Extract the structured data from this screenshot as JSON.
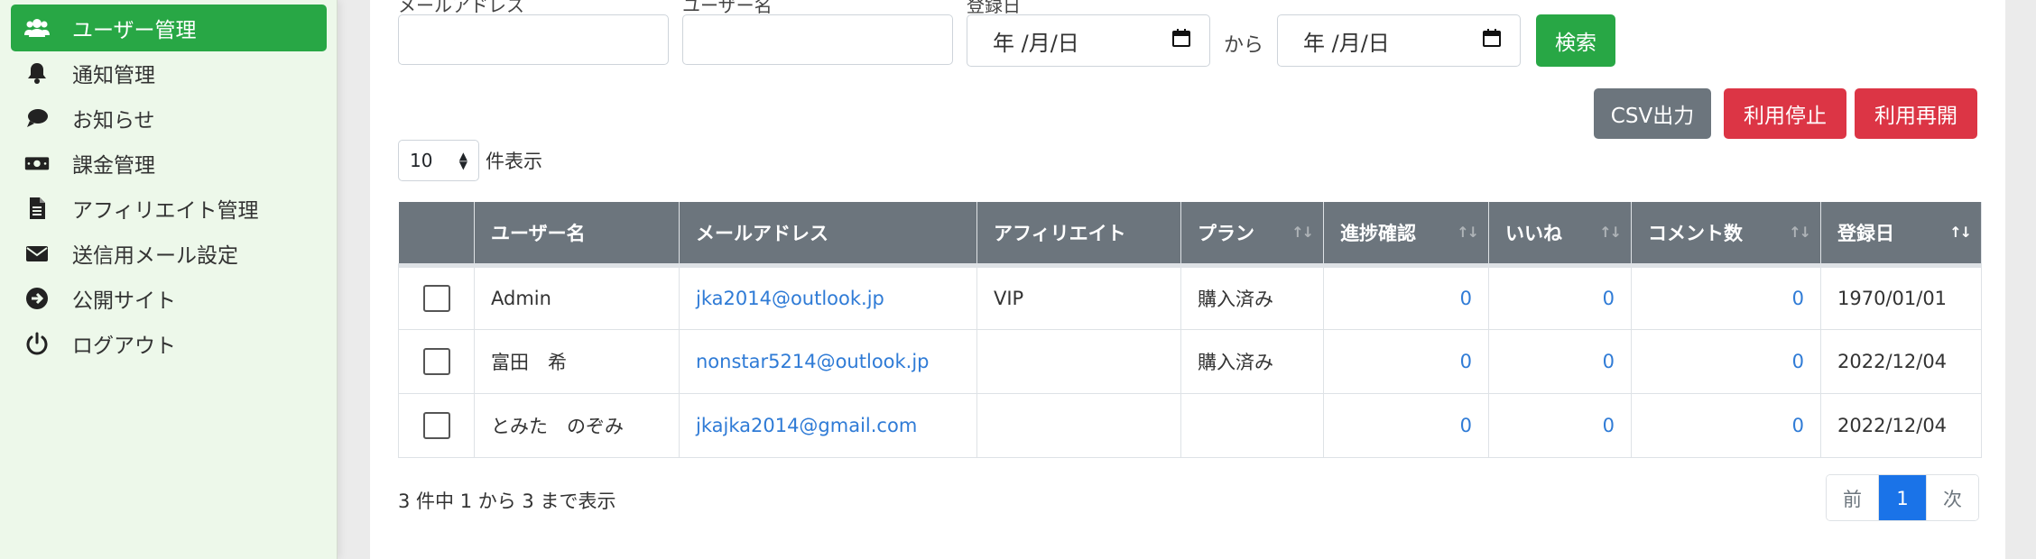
{
  "sidebar": {
    "items": [
      {
        "label": "ユーザー管理",
        "icon": "users-icon",
        "active": true
      },
      {
        "label": "通知管理",
        "icon": "bell-icon"
      },
      {
        "label": "お知らせ",
        "icon": "comment-icon"
      },
      {
        "label": "課金管理",
        "icon": "money-icon"
      },
      {
        "label": "アフィリエイト管理",
        "icon": "document-icon"
      },
      {
        "label": "送信用メール設定",
        "icon": "envelope-icon"
      },
      {
        "label": "公開サイト",
        "icon": "arrow-circle-icon"
      },
      {
        "label": "ログアウト",
        "icon": "power-icon"
      }
    ]
  },
  "filters": {
    "email_label": "メールアドレス",
    "username_label": "ユーザー名",
    "date_label": "登録日",
    "date_from_placeholder": "年 /月/日",
    "date_to_placeholder": "年 /月/日",
    "range_separator": "から",
    "search_button": "検索"
  },
  "actions": {
    "csv": "CSV出力",
    "suspend": "利用停止",
    "resume": "利用再開"
  },
  "page_size": {
    "value": "10",
    "caption": "件表示"
  },
  "table": {
    "headers": [
      "",
      "ユーザー名",
      "メールアドレス",
      "アフィリエイト",
      "プラン",
      "進捗確認",
      "いいね",
      "コメント数",
      "登録日"
    ],
    "rows": [
      {
        "username": "Admin",
        "email": "jka2014@outlook.jp",
        "affiliate": "VIP",
        "plan": "購入済み",
        "progress": "0",
        "likes": "0",
        "comments": "0",
        "registered": "1970/01/01"
      },
      {
        "username": "富田　希",
        "email": "nonstar5214@outlook.jp",
        "affiliate": "",
        "plan": "購入済み",
        "progress": "0",
        "likes": "0",
        "comments": "0",
        "registered": "2022/12/04"
      },
      {
        "username": "とみた　のぞみ",
        "email": "jkajka2014@gmail.com",
        "affiliate": "",
        "plan": "",
        "progress": "0",
        "likes": "0",
        "comments": "0",
        "registered": "2022/12/04"
      }
    ]
  },
  "footer": {
    "summary": "3 件中 1 から 3 まで表示",
    "prev": "前",
    "current_page": "1",
    "next": "次"
  },
  "colors": {
    "primary_green": "#28a745",
    "danger": "#dc3545",
    "secondary": "#6c757d",
    "link": "#2f7bd6",
    "page_active": "#1a73e8"
  }
}
